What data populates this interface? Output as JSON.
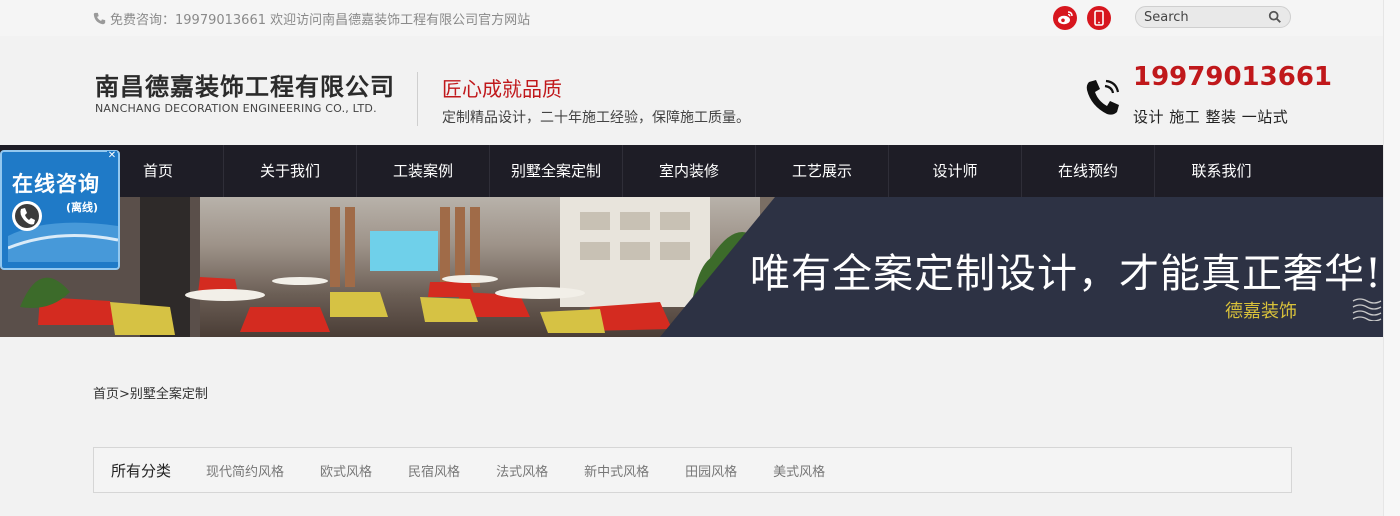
{
  "topbar": {
    "tel_text": "免费咨询：19979013661 欢迎访问南昌德嘉装饰工程有限公司官方网站",
    "search_placeholder": "Search"
  },
  "header": {
    "company_cn": "南昌德嘉装饰工程有限公司",
    "company_en": "NANCHANG DECORATION ENGINEERING CO., LTD.",
    "slogan": "匠心成就品质",
    "slogan_sub": "定制精品设计，二十年施工经验，保障施工质量。",
    "hotline": "19979013661",
    "hotline_sub": "设计 施工 整装 一站式"
  },
  "nav": {
    "items": [
      "首页",
      "关于我们",
      "工装案例",
      "别墅全案定制",
      "室内装修",
      "工艺展示",
      "设计师",
      "在线预约",
      "联系我们"
    ]
  },
  "banner": {
    "title": "唯有全案定制设计，才能真正奢华!",
    "subtitle": "德嘉装饰"
  },
  "consult": {
    "title": "在线咨询",
    "status": "(离线)"
  },
  "breadcrumb": {
    "home": "首页",
    "sep": ">",
    "current": "别墅全案定制"
  },
  "categories": {
    "all_label": "所有分类",
    "items": [
      "现代简约风格",
      "欧式风格",
      "民宿风格",
      "法式风格",
      "新中式风格",
      "田园风格",
      "美式风格"
    ]
  },
  "colors": {
    "accent_red": "#c0181b",
    "nav_bg": "#1e1d26",
    "banner_dark": "#2d3244",
    "consult_blue": "#1f7ac7"
  }
}
